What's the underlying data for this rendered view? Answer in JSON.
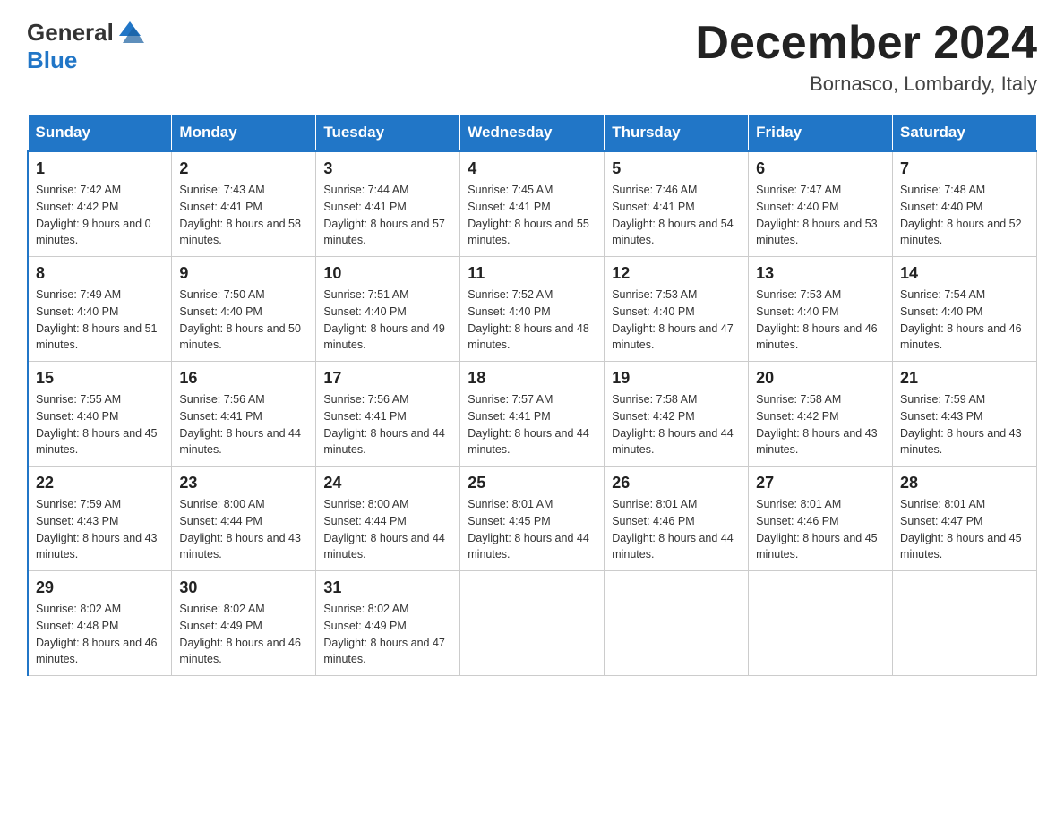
{
  "header": {
    "logo": {
      "general": "General",
      "blue": "Blue"
    },
    "title": "December 2024",
    "location": "Bornasco, Lombardy, Italy"
  },
  "weekdays": [
    "Sunday",
    "Monday",
    "Tuesday",
    "Wednesday",
    "Thursday",
    "Friday",
    "Saturday"
  ],
  "weeks": [
    [
      {
        "day": "1",
        "sunrise": "7:42 AM",
        "sunset": "4:42 PM",
        "daylight": "9 hours and 0 minutes."
      },
      {
        "day": "2",
        "sunrise": "7:43 AM",
        "sunset": "4:41 PM",
        "daylight": "8 hours and 58 minutes."
      },
      {
        "day": "3",
        "sunrise": "7:44 AM",
        "sunset": "4:41 PM",
        "daylight": "8 hours and 57 minutes."
      },
      {
        "day": "4",
        "sunrise": "7:45 AM",
        "sunset": "4:41 PM",
        "daylight": "8 hours and 55 minutes."
      },
      {
        "day": "5",
        "sunrise": "7:46 AM",
        "sunset": "4:41 PM",
        "daylight": "8 hours and 54 minutes."
      },
      {
        "day": "6",
        "sunrise": "7:47 AM",
        "sunset": "4:40 PM",
        "daylight": "8 hours and 53 minutes."
      },
      {
        "day": "7",
        "sunrise": "7:48 AM",
        "sunset": "4:40 PM",
        "daylight": "8 hours and 52 minutes."
      }
    ],
    [
      {
        "day": "8",
        "sunrise": "7:49 AM",
        "sunset": "4:40 PM",
        "daylight": "8 hours and 51 minutes."
      },
      {
        "day": "9",
        "sunrise": "7:50 AM",
        "sunset": "4:40 PM",
        "daylight": "8 hours and 50 minutes."
      },
      {
        "day": "10",
        "sunrise": "7:51 AM",
        "sunset": "4:40 PM",
        "daylight": "8 hours and 49 minutes."
      },
      {
        "day": "11",
        "sunrise": "7:52 AM",
        "sunset": "4:40 PM",
        "daylight": "8 hours and 48 minutes."
      },
      {
        "day": "12",
        "sunrise": "7:53 AM",
        "sunset": "4:40 PM",
        "daylight": "8 hours and 47 minutes."
      },
      {
        "day": "13",
        "sunrise": "7:53 AM",
        "sunset": "4:40 PM",
        "daylight": "8 hours and 46 minutes."
      },
      {
        "day": "14",
        "sunrise": "7:54 AM",
        "sunset": "4:40 PM",
        "daylight": "8 hours and 46 minutes."
      }
    ],
    [
      {
        "day": "15",
        "sunrise": "7:55 AM",
        "sunset": "4:40 PM",
        "daylight": "8 hours and 45 minutes."
      },
      {
        "day": "16",
        "sunrise": "7:56 AM",
        "sunset": "4:41 PM",
        "daylight": "8 hours and 44 minutes."
      },
      {
        "day": "17",
        "sunrise": "7:56 AM",
        "sunset": "4:41 PM",
        "daylight": "8 hours and 44 minutes."
      },
      {
        "day": "18",
        "sunrise": "7:57 AM",
        "sunset": "4:41 PM",
        "daylight": "8 hours and 44 minutes."
      },
      {
        "day": "19",
        "sunrise": "7:58 AM",
        "sunset": "4:42 PM",
        "daylight": "8 hours and 44 minutes."
      },
      {
        "day": "20",
        "sunrise": "7:58 AM",
        "sunset": "4:42 PM",
        "daylight": "8 hours and 43 minutes."
      },
      {
        "day": "21",
        "sunrise": "7:59 AM",
        "sunset": "4:43 PM",
        "daylight": "8 hours and 43 minutes."
      }
    ],
    [
      {
        "day": "22",
        "sunrise": "7:59 AM",
        "sunset": "4:43 PM",
        "daylight": "8 hours and 43 minutes."
      },
      {
        "day": "23",
        "sunrise": "8:00 AM",
        "sunset": "4:44 PM",
        "daylight": "8 hours and 43 minutes."
      },
      {
        "day": "24",
        "sunrise": "8:00 AM",
        "sunset": "4:44 PM",
        "daylight": "8 hours and 44 minutes."
      },
      {
        "day": "25",
        "sunrise": "8:01 AM",
        "sunset": "4:45 PM",
        "daylight": "8 hours and 44 minutes."
      },
      {
        "day": "26",
        "sunrise": "8:01 AM",
        "sunset": "4:46 PM",
        "daylight": "8 hours and 44 minutes."
      },
      {
        "day": "27",
        "sunrise": "8:01 AM",
        "sunset": "4:46 PM",
        "daylight": "8 hours and 45 minutes."
      },
      {
        "day": "28",
        "sunrise": "8:01 AM",
        "sunset": "4:47 PM",
        "daylight": "8 hours and 45 minutes."
      }
    ],
    [
      {
        "day": "29",
        "sunrise": "8:02 AM",
        "sunset": "4:48 PM",
        "daylight": "8 hours and 46 minutes."
      },
      {
        "day": "30",
        "sunrise": "8:02 AM",
        "sunset": "4:49 PM",
        "daylight": "8 hours and 46 minutes."
      },
      {
        "day": "31",
        "sunrise": "8:02 AM",
        "sunset": "4:49 PM",
        "daylight": "8 hours and 47 minutes."
      },
      null,
      null,
      null,
      null
    ]
  ]
}
